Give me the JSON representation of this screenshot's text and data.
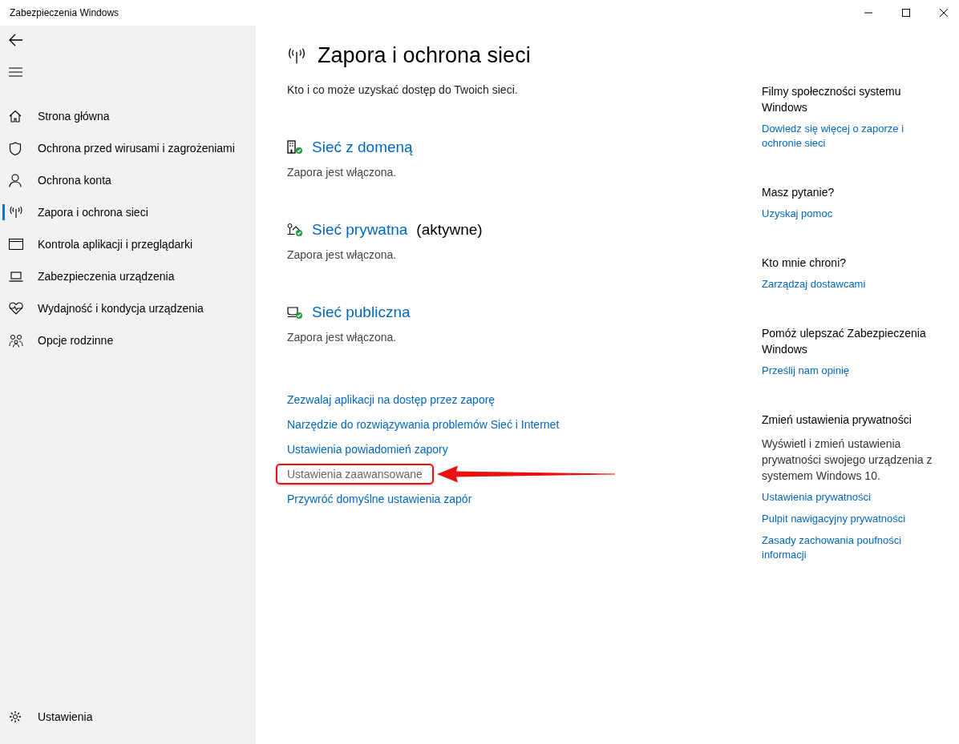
{
  "window": {
    "title": "Zabezpieczenia Windows"
  },
  "sidebar": {
    "items": [
      {
        "label": "Strona główna",
        "kind": "home",
        "selected": false
      },
      {
        "label": "Ochrona przed wirusami i zagrożeniami",
        "kind": "shield",
        "selected": false
      },
      {
        "label": "Ochrona konta",
        "kind": "person",
        "selected": false
      },
      {
        "label": "Zapora i ochrona sieci",
        "kind": "antenna",
        "selected": true
      },
      {
        "label": "Kontrola aplikacji i przeglądarki",
        "kind": "window",
        "selected": false
      },
      {
        "label": "Zabezpieczenia urządzenia",
        "kind": "laptop",
        "selected": false
      },
      {
        "label": "Wydajność i kondycja urządzenia",
        "kind": "heart",
        "selected": false
      },
      {
        "label": "Opcje rodzinne",
        "kind": "family",
        "selected": false
      }
    ],
    "settings": {
      "label": "Ustawienia"
    }
  },
  "page": {
    "title": "Zapora i ochrona sieci",
    "subtitle": "Kto i co może uzyskać dostęp do Twoich sieci.",
    "networks": [
      {
        "name": "Sieć z domeną",
        "kind": "domain",
        "status": "Zapora jest włączona."
      },
      {
        "name": "Sieć prywatna",
        "kind": "private",
        "note": "(aktywne)",
        "status": "Zapora jest włączona."
      },
      {
        "name": "Sieć publiczna",
        "kind": "public",
        "status": "Zapora jest włączona."
      }
    ],
    "links": [
      {
        "label": "Zezwalaj aplikacji na dostęp przez zaporę",
        "highlighted": false
      },
      {
        "label": "Narzędzie do rozwiązywania problemów Sieć i Internet",
        "highlighted": false
      },
      {
        "label": "Ustawienia powiadomień zapory",
        "highlighted": false
      },
      {
        "label": "Ustawienia zaawansowane",
        "highlighted": true
      },
      {
        "label": "Przywróć domyślne ustawienia zapór",
        "highlighted": false
      }
    ]
  },
  "aside": [
    {
      "heading": "Filmy społeczności systemu Windows",
      "links": [
        "Dowiedz się więcej o zaporze i ochronie sieci"
      ]
    },
    {
      "heading": "Masz pytanie?",
      "links": [
        "Uzyskaj pomoc"
      ]
    },
    {
      "heading": "Kto mnie chroni?",
      "links": [
        "Zarządzaj dostawcami"
      ]
    },
    {
      "heading": "Pomóż ulepszać Zabezpieczenia Windows",
      "links": [
        "Prześlij nam opinię"
      ]
    },
    {
      "heading": "Zmień ustawienia prywatności",
      "text": "Wyświetl i zmień ustawienia prywatności swojego urządzenia z systemem Windows 10.",
      "links": [
        "Ustawienia prywatności",
        "Pulpit nawigacyjny prywatności",
        "Zasady zachowania poufności informacji"
      ]
    }
  ]
}
